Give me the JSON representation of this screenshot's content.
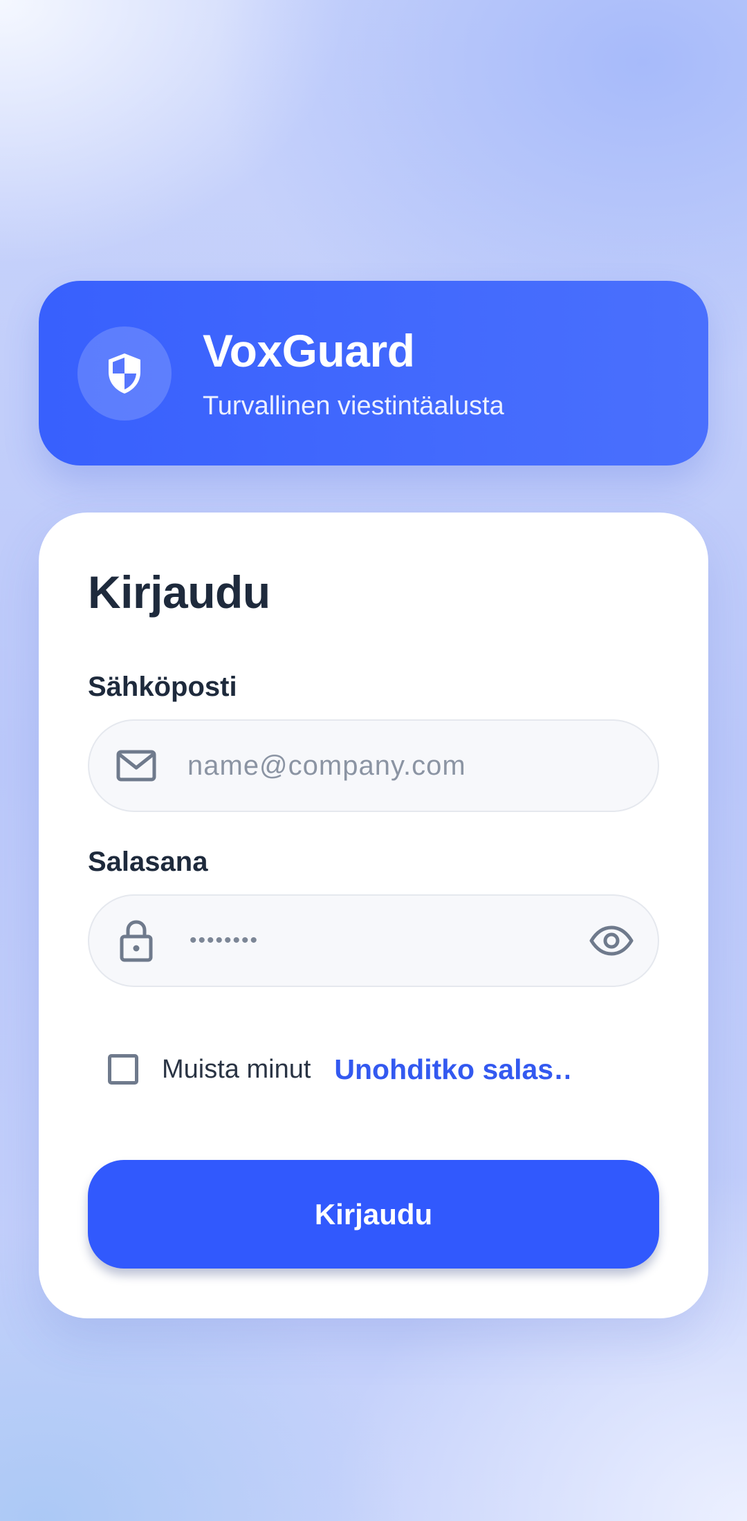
{
  "brand": {
    "name": "VoxGuard",
    "tagline": "Turvallinen viestintäalusta",
    "logo_icon": "shield-icon"
  },
  "login": {
    "title": "Kirjaudu",
    "email": {
      "label": "Sähköposti",
      "placeholder": "name@company.com",
      "value": "",
      "icon": "mail-icon"
    },
    "password": {
      "label": "Salasana",
      "masked_value": "••••••••",
      "icon": "lock-icon",
      "toggle_icon": "eye-icon"
    },
    "remember_me": {
      "label": "Muista minut",
      "checked": false
    },
    "forgot_password": "Unohditko salas…",
    "submit_label": "Kirjaudu"
  },
  "colors": {
    "primary": "#3159fd",
    "brand_card": "#3f66fd",
    "text_dark": "#1e2a3c",
    "link": "#3359f0"
  }
}
